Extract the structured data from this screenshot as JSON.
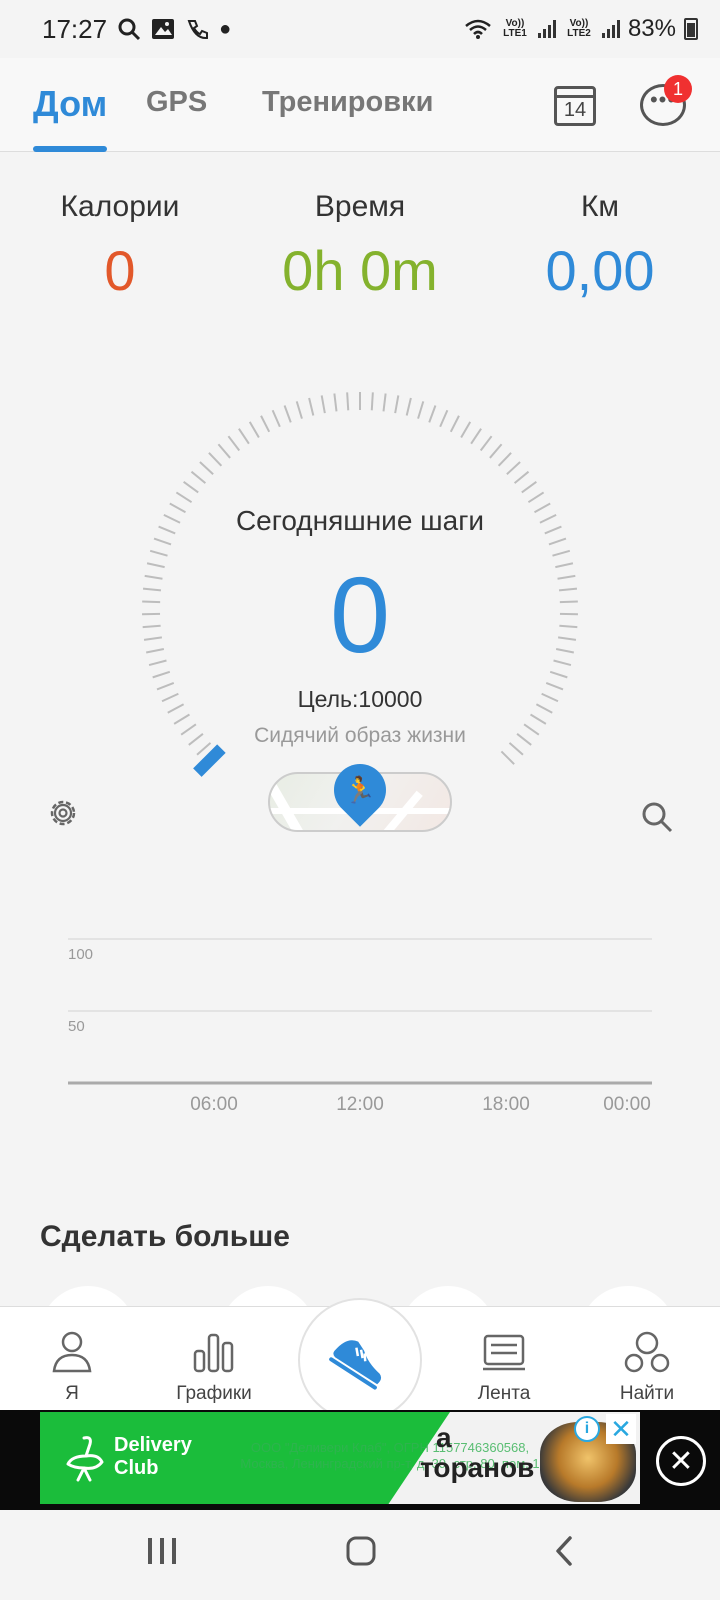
{
  "status_bar": {
    "time": "17:27",
    "sim1_label": "Vo)) LTE1",
    "sim2_label": "Vo)) LTE2",
    "battery": "83%",
    "icons": [
      "search-icon",
      "image-icon",
      "call-forward-icon",
      "dot-icon",
      "wifi-icon",
      "signal-icon",
      "battery-icon"
    ]
  },
  "tabs": [
    {
      "label": "Дом",
      "active": true
    },
    {
      "label": "GPS",
      "active": false
    },
    {
      "label": "Тренировки",
      "active": false
    }
  ],
  "header": {
    "calendar_day": "14",
    "chat_badge": "1"
  },
  "stats": {
    "calories": {
      "label": "Калории",
      "value": "0",
      "color": "#e2582a"
    },
    "time": {
      "label": "Время",
      "value": "0h 0m",
      "color": "#84b22d"
    },
    "km": {
      "label": "Км",
      "value": "0,00",
      "color": "#2f8ad8"
    }
  },
  "gauge": {
    "title": "Сегодняшние шаги",
    "steps": "0",
    "goal": "Цель:10000",
    "status": "Сидячий образ жизни",
    "progress": 0
  },
  "chart": {
    "y_ticks": [
      "100",
      "50"
    ],
    "x_ticks": [
      "06:00",
      "12:00",
      "18:00",
      "00:00"
    ]
  },
  "more_title": "Сделать больше",
  "bottom_nav": [
    {
      "label": "Я",
      "icon": "person-icon"
    },
    {
      "label": "Графики",
      "icon": "bar-chart-icon"
    },
    {
      "label": "",
      "icon": "shoe-icon"
    },
    {
      "label": "Лента",
      "icon": "feed-icon"
    },
    {
      "label": "Найти",
      "icon": "group-icon"
    }
  ],
  "ad": {
    "brand": "Delivery Club",
    "legal": "ООО \"Деливери Клаб\", ОГРН 1157746360568, Москва, Ленинградский пр-т, д. 39, стр. 80, пом. 1",
    "text_a": "а",
    "text_b": "торанов"
  },
  "accent_color": "#2f8ad8"
}
